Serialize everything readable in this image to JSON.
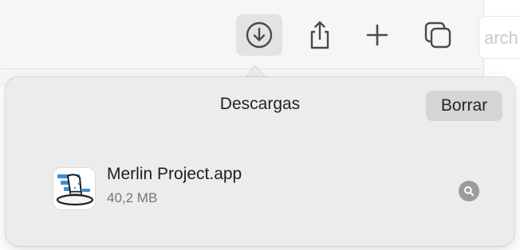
{
  "toolbar": {
    "buttons": [
      {
        "name": "downloads",
        "icon": "download-icon",
        "active": true
      },
      {
        "name": "share",
        "icon": "share-icon"
      },
      {
        "name": "new-tab",
        "icon": "plus-icon"
      },
      {
        "name": "tab-overview",
        "icon": "tab-overview-icon"
      }
    ],
    "search_placeholder_fragment": "arch"
  },
  "downloads_popover": {
    "title": "Descargas",
    "clear_label": "Borrar",
    "items": [
      {
        "name": "Merlin Project.app",
        "size": "40,2 MB",
        "icon": "merlin-app-icon",
        "action_icon": "magnifier-icon"
      }
    ]
  },
  "colors": {
    "toolbar_bg": "#f6f6f6",
    "popover_bg": "#ececec",
    "active_button_bg": "#e3e3e3",
    "clear_button_bg": "#d5d5d5",
    "reveal_button_bg": "#9c9c9c"
  }
}
